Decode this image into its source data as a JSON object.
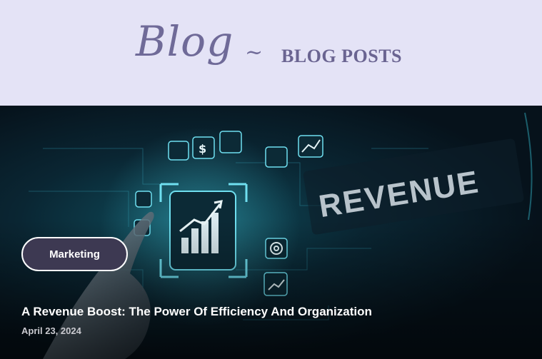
{
  "header": {
    "script_word": "Blog",
    "separator": "~",
    "title": "BLOG POSTS"
  },
  "post": {
    "category": "Marketing",
    "title": "A Revenue Boost: The Power Of Efficiency And Organization",
    "date": "April 23, 2024",
    "image_text": "REVENUE"
  },
  "colors": {
    "header_bg": "#e4e3f6",
    "header_text": "#6f6a98",
    "tag_bg": "#3d3952",
    "accent_cyan": "#5fd0e0"
  }
}
